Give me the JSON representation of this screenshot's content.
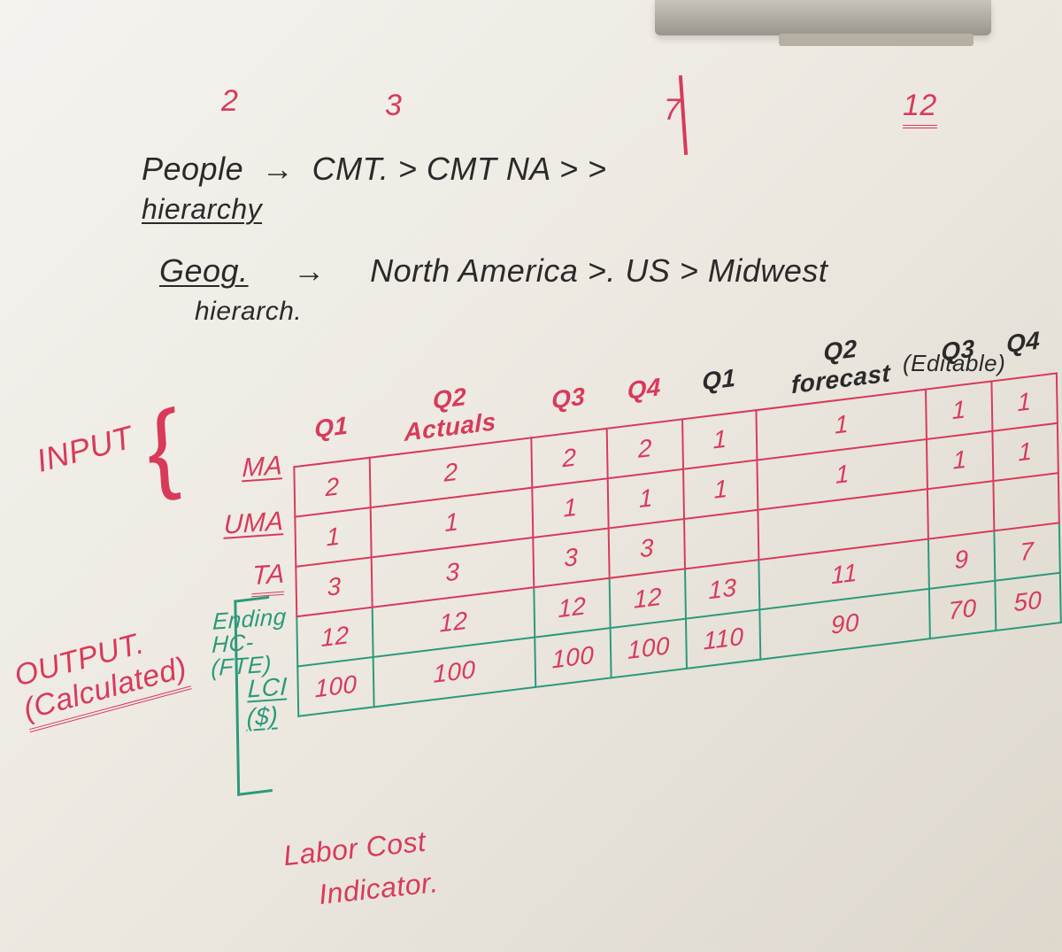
{
  "top_numbers": {
    "n1": "2",
    "n2": "3",
    "n3": "7",
    "n4": "12"
  },
  "people_line": {
    "label": "People",
    "arrow_text": "CMT. >   CMT NA   >   >",
    "sublabel": "hierarchy"
  },
  "geog_line": {
    "label": "Geog.",
    "sublabel": "hierarch.",
    "arrow_text": "North America  >.  US  >  Midwest"
  },
  "headers": {
    "actuals": [
      "Q1",
      "Q2 Actuals",
      "Q3",
      "Q4"
    ],
    "forecast": [
      "Q1",
      "Q2 forecast",
      "Q3",
      "Q4"
    ],
    "editable_note": "(Editable)"
  },
  "rows": {
    "ma": {
      "label": "MA",
      "cells": [
        "2",
        "2",
        "2",
        "2",
        "1",
        "1",
        "1",
        "1"
      ]
    },
    "uma": {
      "label": "UMA",
      "cells": [
        "1",
        "1",
        "1",
        "1",
        "1",
        "1",
        "1",
        "1"
      ]
    },
    "ta": {
      "label": "TA",
      "cells": [
        "3",
        "3",
        "3",
        "3",
        "",
        "",
        "",
        ""
      ]
    },
    "fte": {
      "label": "Ending HC-(FTE)",
      "cells": [
        "12",
        "12",
        "12",
        "12",
        "13",
        "11",
        "9",
        "7"
      ]
    },
    "lci": {
      "label": "LCI ($)",
      "cells": [
        "100",
        "100",
        "100",
        "100",
        "110",
        "90",
        "70",
        "50"
      ]
    }
  },
  "input_label": "INPUT",
  "output_label": "OUTPUT.",
  "output_sublabel": "(Calculated)",
  "lci_note1": "Labor Cost",
  "lci_note2": "Indicator."
}
